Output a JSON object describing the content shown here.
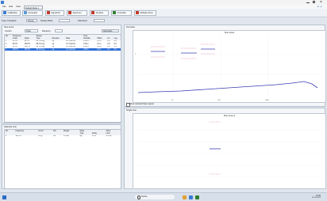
{
  "app": {
    "title": "",
    "menu": [
      "File",
      "Edit",
      "View",
      "Options",
      "Window"
    ],
    "brand": "m·p",
    "combo_value": "Default Mode 1 line"
  },
  "toolbar": {
    "buttons": [
      {
        "label": "Calibration",
        "icon_color": "#3a7bd5"
      },
      {
        "label": "Generator",
        "icon_color": "#5c9ad6"
      },
      {
        "label": "Signal Mx",
        "icon_color": "#c0392b"
      },
      {
        "label": "Spectrum",
        "icon_color": "#c0392b"
      },
      {
        "label": "Timeline",
        "icon_color": "#c0392b"
      },
      {
        "label": "Controller",
        "icon_color": "#2e7d32"
      },
      {
        "label": "Multiple Sinus",
        "icon_color": "#c0392b"
      }
    ]
  },
  "settings": {
    "type_label": "Type of analysis",
    "type_value": "Sweep",
    "sweep_label": "Sweep Mode",
    "start_label": "Start level"
  },
  "sine_tones": {
    "title": "Sine tones",
    "control_label": "Control",
    "control_value": "Peak",
    "damping_label": "Damping",
    "accumulate_label": "Automatic...",
    "group_headers": [
      "Frequency",
      "Sweep",
      "Time"
    ],
    "headers": [
      "No.",
      "Lower",
      "Upper",
      "Type",
      "Direction",
      "Rate",
      "Duration",
      "Offset",
      "Lin",
      "Log"
    ],
    "rows": [
      {
        "no": "1",
        "lower": "20 Hz",
        "upper": "80 Hz",
        "type": "80 Hz Log",
        "direction": "up",
        "rate": "0.1 Oct/min",
        "duration": "2:00 s",
        "offset": "0.0 s",
        "lin": "0.0",
        "log": "0.0"
      },
      {
        "no": "2",
        "lower": "80 Hz",
        "upper": "160 Hz",
        "type": "80 Hz Log",
        "direction": "up",
        "rate": "0.1 Oct/min",
        "duration": "2:00 s",
        "offset": "0.0 s",
        "lin": "0.0",
        "log": "0.0"
      },
      {
        "no": "3",
        "lower": "40 Hz",
        "upper": "160 Hz",
        "type": "80 Hz Log",
        "direction": "up",
        "rate": "0.1 Oct/min",
        "duration": "2:00 s",
        "offset": "0.0 s",
        "lin": "0.0",
        "log": "0.0"
      },
      {
        "no": "4",
        "lower": "160 Hz",
        "upper": "160 Hz",
        "type": "80 Hz Log",
        "direction": "up",
        "rate": "0.1 Oct/min",
        "duration": "2:00 s",
        "offset": "0.0 s",
        "lin": "0.0",
        "log": "0.0"
      }
    ]
  },
  "selected_tone": {
    "title": "Selected tone",
    "headers": [
      "No.",
      "Frequency",
      "Ac.ctrl",
      "%G",
      "Weight",
      "Slope",
      "Abort"
    ],
    "sub_headers": [
      "Type",
      "Delay",
      "Limit"
    ],
    "row": {
      "no": "1",
      "freq": "120 Hz",
      "acctrl": "0.0 g",
      "pct": "0.0",
      "weight": "0.0 dB",
      "type": "log",
      "delay": "0.0 s",
      "limit": "6.0 dB"
    }
  },
  "overview": {
    "title": "Overview",
    "chart_title": "Sine tones",
    "checkbox_label": "Show reduced base signal"
  },
  "single": {
    "title": "Single tone",
    "chart_title": "Sine tones 4"
  },
  "taskbar": {
    "search_placeholder": "Suche",
    "time": "10:49",
    "date": "01.06.2021"
  },
  "colors": {
    "accent": "#3b3bb5",
    "limit_pink": "#e07aa0",
    "row_selected": "#2f6fd6"
  }
}
